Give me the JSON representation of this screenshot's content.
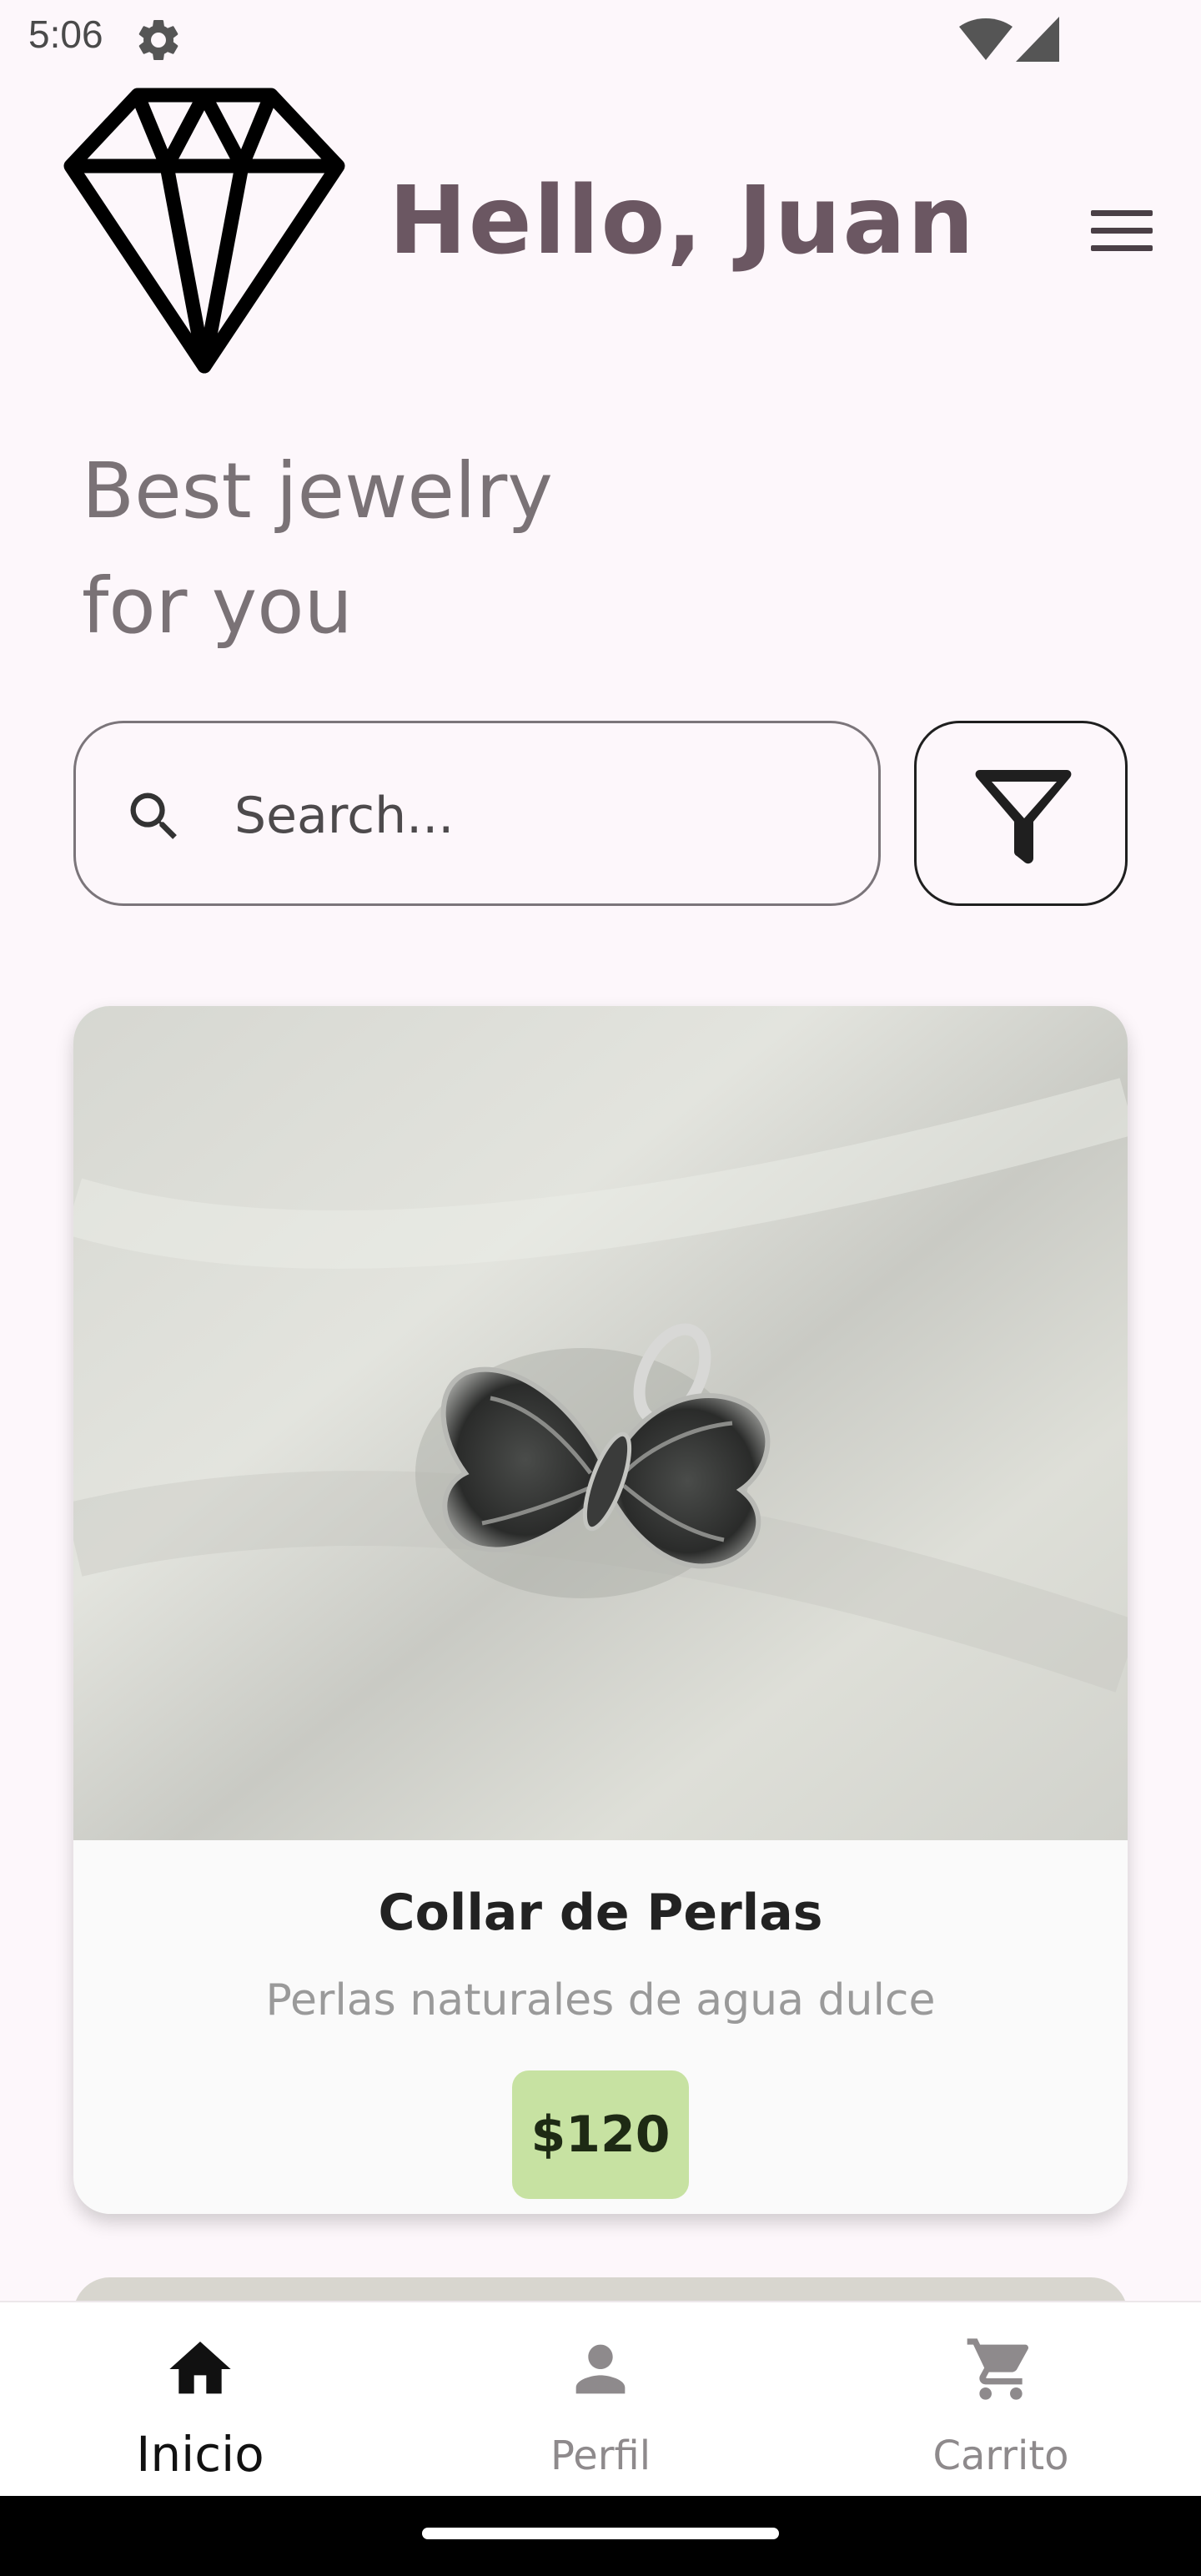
{
  "status_bar": {
    "time": "5:06",
    "icons": [
      "settings-gear-icon",
      "wifi-icon",
      "cell-signal-icon"
    ]
  },
  "header": {
    "logo_icon": "diamond-icon",
    "greeting": "Hello, Juan",
    "menu_icon": "hamburger-menu-icon"
  },
  "tagline": {
    "line1": "Best jewelry",
    "line2": "for you"
  },
  "search": {
    "icon": "search-icon",
    "placeholder": "Search...",
    "value": "",
    "filter_icon": "filter-funnel-icon"
  },
  "products": [
    {
      "name": "Collar de Perlas",
      "description": "Perlas naturales de agua dulce",
      "price": "$120",
      "image": "silver-butterfly-pendant-photo"
    }
  ],
  "bottom_nav": {
    "items": [
      {
        "label": "Inicio",
        "icon": "home-icon",
        "active": true
      },
      {
        "label": "Perfil",
        "icon": "person-icon",
        "active": false
      },
      {
        "label": "Carrito",
        "icon": "shopping-cart-icon",
        "active": false
      }
    ]
  },
  "colors": {
    "background": "#fdf7fb",
    "greeting": "#6b5762",
    "price_badge": "#c7e2a2",
    "nav_active": "#111111",
    "nav_inactive": "#8e8a8c"
  }
}
